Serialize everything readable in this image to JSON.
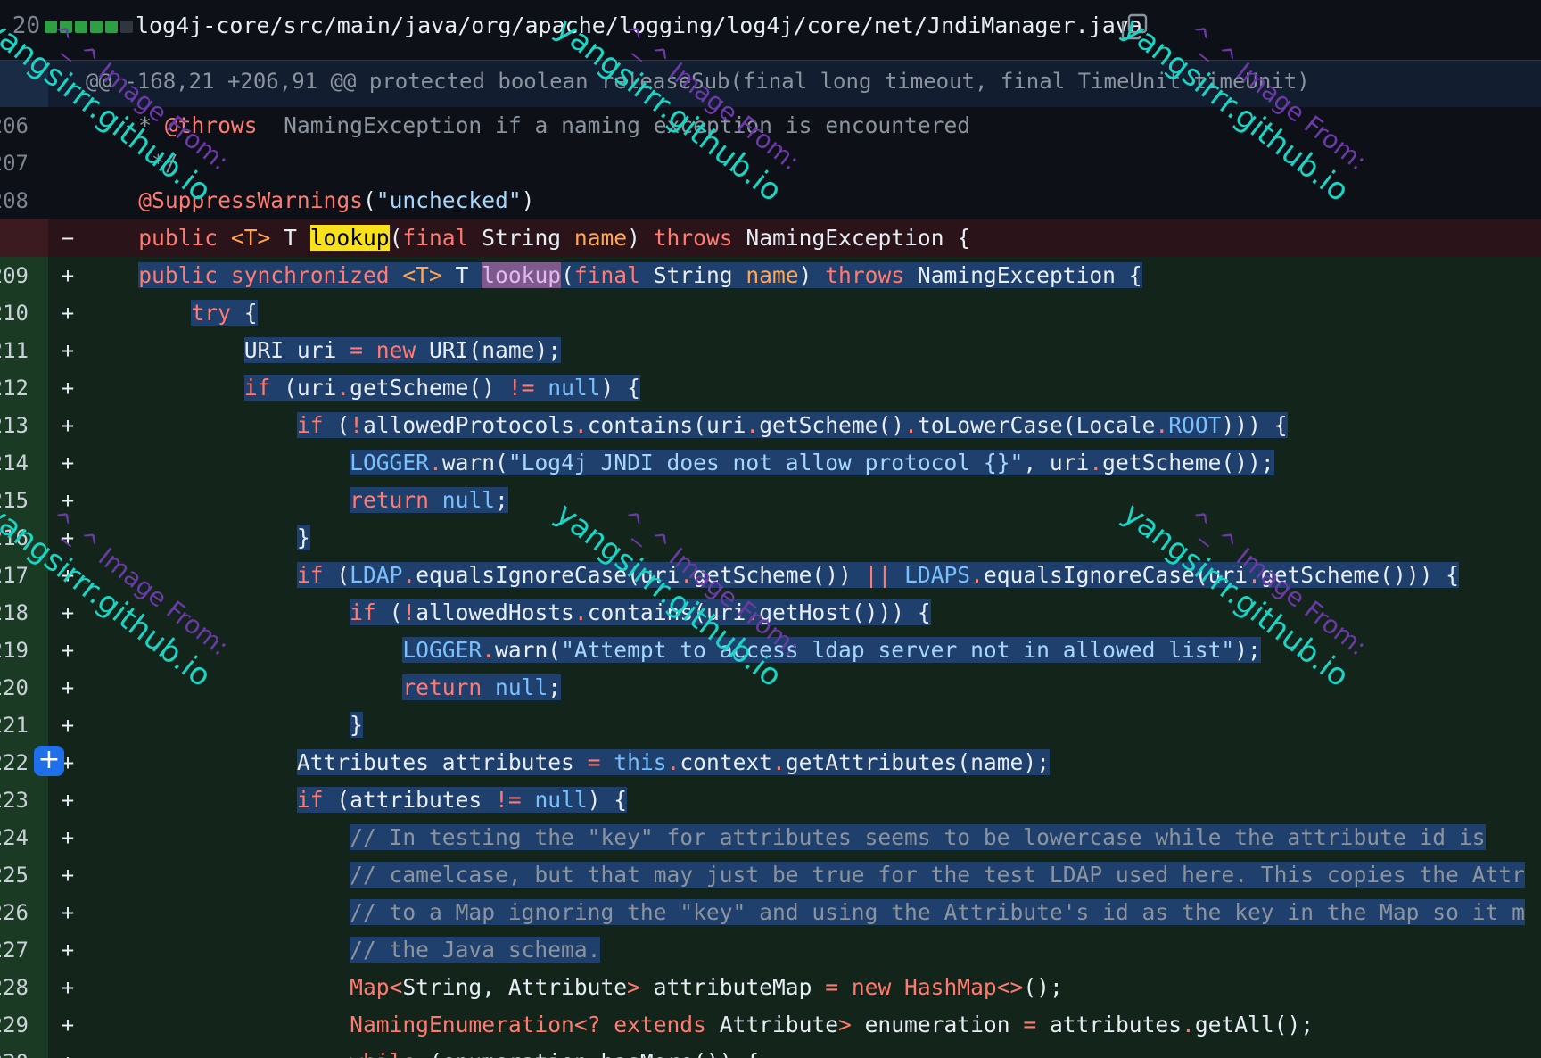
{
  "header": {
    "count": "20",
    "diffstat_colors": [
      "#2ea043",
      "#2ea043",
      "#2ea043",
      "#2ea043",
      "#2ea043",
      "#30363d"
    ],
    "path": "log4j-core/src/main/java/org/apache/logging/log4j/core/net/JndiManager.java",
    "copy_icon": "copy-icon"
  },
  "hunk": {
    "text": "@@ -168,21 +206,91 @@ protected boolean releaseSub(final long timeout, final TimeUnit timeUnit)"
  },
  "lines": [
    {
      "num": "206",
      "sign": "",
      "type": "ctx",
      "indent": "    ",
      "tokens": [
        [
          "cm",
          "* "
        ],
        [
          "ann",
          "@throws"
        ],
        [
          "cm",
          "  NamingException if a naming exception is encountered"
        ]
      ]
    },
    {
      "num": "207",
      "sign": "",
      "type": "ctx",
      "indent": "    ",
      "tokens": [
        [
          "cm",
          " */"
        ]
      ]
    },
    {
      "num": "208",
      "sign": "",
      "type": "ctx",
      "indent": "    ",
      "tokens": [
        [
          "ann",
          "@SuppressWarnings"
        ],
        [
          "type",
          "("
        ],
        [
          "str",
          "\"unchecked\""
        ],
        [
          "type",
          ")"
        ]
      ]
    },
    {
      "num": "",
      "sign": "−",
      "type": "del",
      "indent": "    ",
      "tokens": [
        [
          "kw",
          "public "
        ],
        [
          "param",
          "<T>"
        ],
        [
          "type",
          " T "
        ],
        [
          "hl",
          "lookup"
        ],
        [
          "type",
          "("
        ],
        [
          "kw",
          "final "
        ],
        [
          "type",
          "String "
        ],
        [
          "param",
          "name"
        ],
        [
          "type",
          ") "
        ],
        [
          "kw",
          "throws "
        ],
        [
          "type",
          "NamingException {"
        ]
      ]
    },
    {
      "num": "209",
      "sign": "+",
      "type": "add",
      "indent": "    ",
      "sel": true,
      "tokens": [
        [
          "kw",
          "public synchronized "
        ],
        [
          "param",
          "<T>"
        ],
        [
          "type",
          " T "
        ],
        [
          "hl2",
          "lookup"
        ],
        [
          "type",
          "("
        ],
        [
          "kw",
          "final "
        ],
        [
          "type",
          "String "
        ],
        [
          "param",
          "name"
        ],
        [
          "type",
          ") "
        ],
        [
          "kw",
          "throws "
        ],
        [
          "type",
          "NamingException {"
        ]
      ]
    },
    {
      "num": "210",
      "sign": "+",
      "type": "add",
      "indent": "        ",
      "sel": true,
      "tokens": [
        [
          "kw",
          "try"
        ],
        [
          "type",
          " {"
        ]
      ]
    },
    {
      "num": "211",
      "sign": "+",
      "type": "add",
      "indent": "            ",
      "sel": true,
      "tokens": [
        [
          "type",
          "URI uri "
        ],
        [
          "kw",
          "= new "
        ],
        [
          "type",
          "URI(name);"
        ]
      ]
    },
    {
      "num": "212",
      "sign": "+",
      "type": "add",
      "indent": "            ",
      "sel": true,
      "tokens": [
        [
          "kw",
          "if "
        ],
        [
          "type",
          "(uri"
        ],
        [
          "kw",
          "."
        ],
        [
          "type",
          "getScheme() "
        ],
        [
          "kw",
          "!= "
        ],
        [
          "const",
          "null"
        ],
        [
          "type",
          ") {"
        ]
      ]
    },
    {
      "num": "213",
      "sign": "+",
      "type": "add",
      "indent": "                ",
      "sel": true,
      "tokens": [
        [
          "kw",
          "if "
        ],
        [
          "type",
          "("
        ],
        [
          "kw",
          "!"
        ],
        [
          "type",
          "allowedProtocols"
        ],
        [
          "kw",
          "."
        ],
        [
          "type",
          "contains(uri"
        ],
        [
          "kw",
          "."
        ],
        [
          "type",
          "getScheme()"
        ],
        [
          "kw",
          "."
        ],
        [
          "type",
          "toLowerCase(Locale"
        ],
        [
          "kw",
          "."
        ],
        [
          "const",
          "ROOT"
        ],
        [
          "type",
          ")))"
        ],
        [
          "type",
          " {"
        ]
      ]
    },
    {
      "num": "214",
      "sign": "+",
      "type": "add",
      "indent": "                    ",
      "sel": true,
      "tokens": [
        [
          "const",
          "LOGGER"
        ],
        [
          "kw",
          "."
        ],
        [
          "type",
          "warn("
        ],
        [
          "str",
          "\"Log4j JNDI does not allow protocol {}\""
        ],
        [
          "type",
          ", uri"
        ],
        [
          "kw",
          "."
        ],
        [
          "type",
          "getScheme());"
        ]
      ]
    },
    {
      "num": "215",
      "sign": "+",
      "type": "add",
      "indent": "                    ",
      "sel": true,
      "tokens": [
        [
          "kw",
          "return "
        ],
        [
          "const",
          "null"
        ],
        [
          "type",
          ";"
        ]
      ]
    },
    {
      "num": "216",
      "sign": "+",
      "type": "add",
      "indent": "                ",
      "sel": true,
      "tokens": [
        [
          "type",
          "}"
        ]
      ]
    },
    {
      "num": "217",
      "sign": "+",
      "type": "add",
      "indent": "                ",
      "sel": true,
      "tokens": [
        [
          "kw",
          "if "
        ],
        [
          "type",
          "("
        ],
        [
          "const",
          "LDAP"
        ],
        [
          "kw",
          "."
        ],
        [
          "type",
          "equalsIgnoreCase(uri"
        ],
        [
          "kw",
          "."
        ],
        [
          "type",
          "getScheme()) "
        ],
        [
          "kw",
          "|| "
        ],
        [
          "const",
          "LDAPS"
        ],
        [
          "kw",
          "."
        ],
        [
          "type",
          "equalsIgnoreCase(uri"
        ],
        [
          "kw",
          "."
        ],
        [
          "type",
          "getScheme())) {"
        ]
      ]
    },
    {
      "num": "218",
      "sign": "+",
      "type": "add",
      "indent": "                    ",
      "sel": true,
      "tokens": [
        [
          "kw",
          "if "
        ],
        [
          "type",
          "("
        ],
        [
          "kw",
          "!"
        ],
        [
          "type",
          "allowedHosts"
        ],
        [
          "kw",
          "."
        ],
        [
          "type",
          "contains(uri"
        ],
        [
          "kw",
          "."
        ],
        [
          "type",
          "getHost())) {"
        ]
      ]
    },
    {
      "num": "219",
      "sign": "+",
      "type": "add",
      "indent": "                        ",
      "sel": true,
      "tokens": [
        [
          "const",
          "LOGGER"
        ],
        [
          "kw",
          "."
        ],
        [
          "type",
          "warn("
        ],
        [
          "str",
          "\"Attempt to access ldap server not in allowed list\""
        ],
        [
          "type",
          ");"
        ]
      ]
    },
    {
      "num": "220",
      "sign": "+",
      "type": "add",
      "indent": "                        ",
      "sel": true,
      "tokens": [
        [
          "kw",
          "return "
        ],
        [
          "const",
          "null"
        ],
        [
          "type",
          ";"
        ]
      ]
    },
    {
      "num": "221",
      "sign": "+",
      "type": "add",
      "indent": "                    ",
      "sel": true,
      "tokens": [
        [
          "type",
          "}"
        ]
      ]
    },
    {
      "num": "222",
      "sign": "+",
      "type": "add",
      "indent": "                ",
      "sel": true,
      "tokens": [
        [
          "type",
          "Attributes attributes "
        ],
        [
          "kw",
          "= "
        ],
        [
          "const",
          "this"
        ],
        [
          "kw",
          "."
        ],
        [
          "type",
          "context"
        ],
        [
          "kw",
          "."
        ],
        [
          "type",
          "getAttributes(name);"
        ]
      ]
    },
    {
      "num": "223",
      "sign": "+",
      "type": "add",
      "indent": "                ",
      "sel": true,
      "tokens": [
        [
          "kw",
          "if "
        ],
        [
          "type",
          "(attributes "
        ],
        [
          "kw",
          "!= "
        ],
        [
          "const",
          "null"
        ],
        [
          "type",
          ") {"
        ]
      ]
    },
    {
      "num": "224",
      "sign": "+",
      "type": "add",
      "indent": "                    ",
      "sel": true,
      "tokens": [
        [
          "cm",
          "// In testing the \"key\" for attributes seems to be lowercase while the attribute id is"
        ]
      ]
    },
    {
      "num": "225",
      "sign": "+",
      "type": "add",
      "indent": "                    ",
      "sel": true,
      "tokens": [
        [
          "cm",
          "// camelcase, but that may just be true for the test LDAP used here. This copies the Attr"
        ]
      ]
    },
    {
      "num": "226",
      "sign": "+",
      "type": "add",
      "indent": "                    ",
      "sel": true,
      "tokens": [
        [
          "cm",
          "// to a Map ignoring the \"key\" and using the Attribute's id as the key in the Map so it m"
        ]
      ]
    },
    {
      "num": "227",
      "sign": "+",
      "type": "add",
      "indent": "                    ",
      "sel": true,
      "tokens": [
        [
          "cm",
          "// the Java schema."
        ]
      ]
    },
    {
      "num": "228",
      "sign": "+",
      "type": "add",
      "indent": "                    ",
      "tokens": [
        [
          "kw",
          "Map<"
        ],
        [
          "type",
          "String, Attribute"
        ],
        [
          "kw",
          "> "
        ],
        [
          "type",
          "attributeMap "
        ],
        [
          "kw",
          "= new HashMap<>"
        ],
        [
          "type",
          "();"
        ]
      ]
    },
    {
      "num": "229",
      "sign": "+",
      "type": "add",
      "indent": "                    ",
      "tokens": [
        [
          "kw",
          "NamingEnumeration<? extends "
        ],
        [
          "type",
          "Attribute"
        ],
        [
          "kw",
          "> "
        ],
        [
          "type",
          "enumeration "
        ],
        [
          "kw",
          "= "
        ],
        [
          "type",
          "attributes"
        ],
        [
          "kw",
          "."
        ],
        [
          "type",
          "getAll();"
        ]
      ]
    },
    {
      "num": "230",
      "sign": "+",
      "type": "add",
      "indent": "                    ",
      "tokens": [
        [
          "kw",
          "while "
        ],
        [
          "type",
          "(enumeration"
        ],
        [
          "kw",
          "."
        ],
        [
          "type",
          "hasMore()) {"
        ]
      ]
    }
  ],
  "watermark": {
    "site": "yangsirrr.github.io",
    "prefix": "^_^ Image From:"
  }
}
